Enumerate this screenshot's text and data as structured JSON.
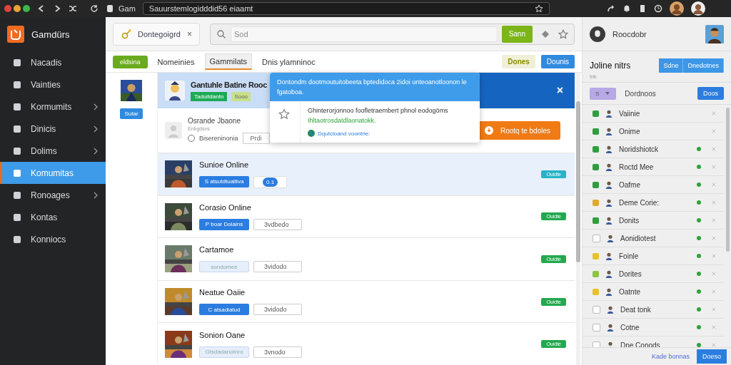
{
  "browser": {
    "tab_title": "Gam",
    "url": "Sauurstemlogidddid56 eiaamt"
  },
  "sidebar": {
    "brand": "Gamdürs",
    "items": [
      {
        "label": "Nacadis",
        "selected": false,
        "arrow": false
      },
      {
        "label": "Vainties",
        "selected": false,
        "arrow": false
      },
      {
        "label": "Kormumits",
        "selected": false,
        "arrow": true
      },
      {
        "label": "Dinicis",
        "selected": false,
        "arrow": true
      },
      {
        "label": "Dolims",
        "selected": false,
        "arrow": true
      },
      {
        "label": "Komumitas",
        "selected": true,
        "arrow": false
      },
      {
        "label": "Ronoages",
        "selected": false,
        "arrow": true
      },
      {
        "label": "Kontas",
        "selected": false,
        "arrow": false
      },
      {
        "label": "Konniocs",
        "selected": false,
        "arrow": false
      }
    ]
  },
  "toolbar": {
    "tab": "Dontegoigrd",
    "close": "×",
    "search": {
      "placeholder": "Sod"
    },
    "search_button": "Sann"
  },
  "filters": {
    "chip": "eldsina",
    "tabs": [
      {
        "label": "Nomeinies",
        "selected": false
      },
      {
        "label": "Gammilats",
        "selected": true
      },
      {
        "label": "Dnis ylamninoc",
        "selected": false
      }
    ],
    "buttons": [
      {
        "label": "Dones",
        "kind": "highlight"
      },
      {
        "label": "Dounis",
        "kind": "primary"
      }
    ]
  },
  "side_column": {
    "button": "Sutar"
  },
  "featured": {
    "title": "Gantuhle Batine Rooc",
    "badge": "Taduitdantn",
    "tag": "Sooo",
    "close": "×"
  },
  "suggestion": {
    "title": "Osrande Jbaone",
    "subtitle": "Enbgdsvs",
    "option": "Bisereninonia",
    "option_checked": false,
    "button": "Prdi",
    "action": "Rootq te bdoles"
  },
  "games": [
    {
      "title": "Sunioe Online",
      "primary": "S atsutdtualtiva",
      "disabled": false,
      "secondary": {
        "kind": "count",
        "text": "0.1"
      },
      "status": "Ouidte",
      "color": "#26b3c7",
      "selected": true
    },
    {
      "title": "Corasio Online",
      "primary": "P boar Dolains",
      "disabled": false,
      "secondary": {
        "kind": "select",
        "text": "3vdbedo"
      },
      "status": "Ouidte",
      "color": "#22a94f",
      "selected": false
    },
    {
      "title": "Cartamoe",
      "primary": "sundomee",
      "disabled": true,
      "secondary": {
        "kind": "select",
        "text": "3vidodo"
      },
      "status": "Ouidte",
      "color": "#22a94f",
      "selected": false
    },
    {
      "title": "Neatue Oaiie",
      "primary": "C atsadiatud",
      "disabled": false,
      "secondary": {
        "kind": "select",
        "text": "3vidodo"
      },
      "status": "Ouidte",
      "color": "#22a94f",
      "selected": false
    },
    {
      "title": "Sonion Oane",
      "primary": "Gtsdadanotnro",
      "disabled": true,
      "secondary": {
        "kind": "select",
        "text": "3vnodo"
      },
      "status": "Ouidte",
      "color": "#22a94f",
      "selected": false
    }
  ],
  "popover": {
    "title": "Dontondm dootmoutuitobeeta bptedidoca 2idoi unteoanotloonon le fgatoboa.",
    "body": "Ghinterorjonnoo foofletraembert phnol eodogöms",
    "note": "Ihltaotrosdatdlaonatokk.",
    "link": "Dqutcloand voontrle:"
  },
  "panel": {
    "user": "Roocdobr",
    "heading": "Joline nitrs",
    "segments": [
      "Sdne",
      "Dnedotnes"
    ],
    "caption": "Inb",
    "filter": "S",
    "filter_label": "Dordnoos",
    "filter_button": "Doos",
    "contacts": [
      {
        "name": "Vaiinie",
        "color": "#2e9e3e",
        "online": false
      },
      {
        "name": "Onime",
        "color": "#2e9e3e",
        "online": false
      },
      {
        "name": "Noridshiotck",
        "color": "#2e9e3e",
        "online": true
      },
      {
        "name": "Roctd Mee",
        "color": "#2e9e3e",
        "online": true
      },
      {
        "name": "Oafme",
        "color": "#2e9e3e",
        "online": true
      },
      {
        "name": "Deme Corie:",
        "color": "#e0a92a",
        "online": true
      },
      {
        "name": "Donits",
        "color": "#2e9e3e",
        "online": true
      },
      {
        "name": "Aonidiotest",
        "checked": false,
        "online": true
      },
      {
        "name": "Foinle",
        "color": "#e6c229",
        "online": true
      },
      {
        "name": "Dorites",
        "color": "#8cc63f",
        "online": true
      },
      {
        "name": "Oatnte",
        "color": "#e6c229",
        "online": true
      },
      {
        "name": "Deat tonk",
        "checked": false,
        "online": true
      },
      {
        "name": "Cotne",
        "checked": false,
        "online": true
      },
      {
        "name": "Dne Conods",
        "checked": false,
        "online": true
      }
    ],
    "footer_link": "Kade bonnas",
    "footer_button": "Doeso"
  }
}
